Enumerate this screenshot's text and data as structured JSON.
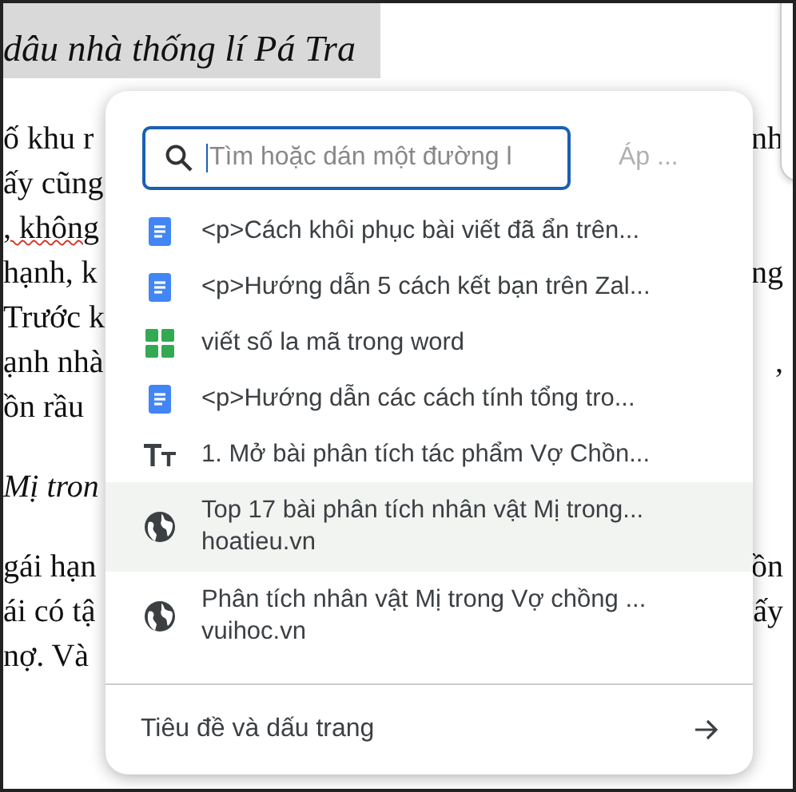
{
  "document": {
    "heading": "dâu nhà thống lí Pá Tra",
    "paragraphs": [
      [
        {
          "left": "ố khu r",
          "right": "nh"
        },
        {
          "left": "ấy cũng"
        },
        {
          "left": ", không",
          "misspelled": true
        },
        {
          "left": "hạnh, k",
          "right": "ng"
        },
        {
          "left": "Trước k"
        },
        {
          "left": "ạnh nhà",
          "right": ","
        },
        {
          "left": "ồn rầu"
        }
      ],
      [
        {
          "left": "Mị tron",
          "italic": true
        }
      ],
      [
        {
          "left": "gái hạn",
          "right": "ồn"
        },
        {
          "left": "ái có tậ",
          "right": "ấy"
        },
        {
          "left": "nợ. Và"
        }
      ]
    ]
  },
  "popup": {
    "search": {
      "placeholder": "Tìm hoặc dán một đường l"
    },
    "apply_button": {
      "label": "Áp ...",
      "disabled": true
    },
    "items": [
      {
        "kind": "doc",
        "title": "<p>Cách khôi phục bài viết đã ẩn trên...",
        "selected": false
      },
      {
        "kind": "doc",
        "title": "<p>Hướng dẫn 5 cách kết bạn trên Zal...",
        "selected": false
      },
      {
        "kind": "sheet",
        "title": "viết số la mã trong word",
        "selected": false
      },
      {
        "kind": "doc",
        "title": "<p>Hướng dẫn các cách tính tổng tro...",
        "selected": false
      },
      {
        "kind": "heading",
        "title": "1. Mở bài phân tích tác phẩm Vợ Chồn...",
        "selected": false
      },
      {
        "kind": "web",
        "title": "Top 17 bài phân tích nhân vật Mị trong...",
        "site": "hoatieu.vn",
        "selected": true
      },
      {
        "kind": "web",
        "title": "Phân tích nhân vật Mị trong Vợ chồng ...",
        "site": "vuihoc.vn",
        "selected": false
      }
    ],
    "footer": {
      "label": "Tiêu đề và dấu trang"
    }
  }
}
